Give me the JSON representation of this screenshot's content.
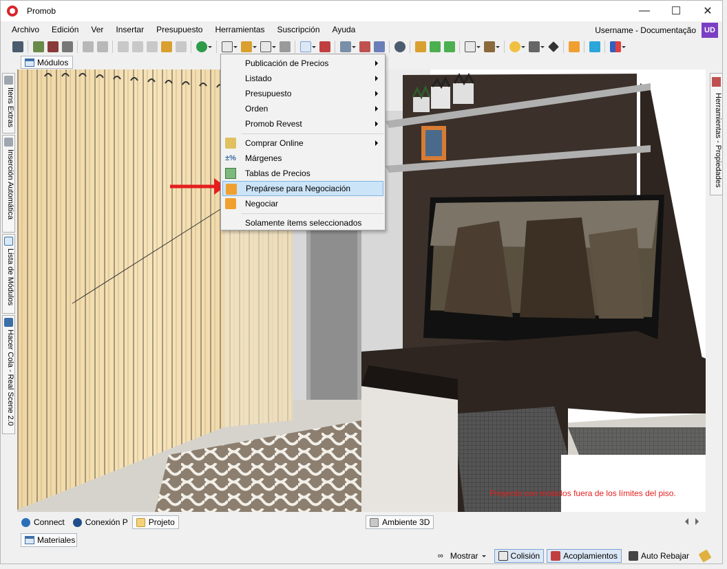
{
  "window": {
    "title": "Promob",
    "minimize": "—",
    "maximize": "☐",
    "close": "✕"
  },
  "menubar": {
    "items": [
      "Archivo",
      "Edición",
      "Ver",
      "Insertar",
      "Presupuesto",
      "Herramientas",
      "Suscripción",
      "Ayuda"
    ],
    "username": "Username - Documentação",
    "avatar_initials": "UD"
  },
  "modules_tab": {
    "label": "Módulos"
  },
  "left_sidebar": {
    "tabs": [
      "Itens Extras",
      "Inserción Automática",
      "Lista de Módulos",
      "Hacer Cola - Real Scene 2.0"
    ]
  },
  "right_sidebar": {
    "tab": "Herramientas - Propiedades"
  },
  "dropdown": {
    "items": [
      {
        "label": "Publicación de Precios",
        "submenu": true,
        "icon": ""
      },
      {
        "label": "Listado",
        "submenu": true,
        "icon": ""
      },
      {
        "label": "Presupuesto",
        "submenu": true,
        "icon": ""
      },
      {
        "label": "Orden",
        "submenu": true,
        "icon": ""
      },
      {
        "label": "Promob Revest",
        "submenu": true,
        "icon": ""
      },
      {
        "label": "Comprar Online",
        "submenu": true,
        "icon": "cart-money-icon"
      },
      {
        "label": "Márgenes",
        "submenu": false,
        "icon": "percent-icon"
      },
      {
        "label": "Tablas de Precios",
        "submenu": false,
        "icon": "price-table-icon"
      },
      {
        "label": "Prepárese para Negociación",
        "submenu": false,
        "icon": "save-disk-icon",
        "highlighted": true
      },
      {
        "label": "Negociar",
        "submenu": false,
        "icon": "person-icon"
      },
      {
        "label": "Solamente ítems seleccionados",
        "submenu": false,
        "icon": ""
      }
    ]
  },
  "viewport": {
    "warning": "Proyecto con módulos fuera de los límites del piso."
  },
  "bottom_tabs": {
    "items": [
      "Connect",
      "Conexión P",
      "Projeto"
    ],
    "active": "Projeto",
    "scene_tab": "Ambiente 3D"
  },
  "materials_tab": {
    "label": "Materiales"
  },
  "statusbar": {
    "show": "Mostrar",
    "collision": "Colisión",
    "couplings": "Acoplamientos",
    "auto_lower": "Auto Rebajar"
  },
  "colors": {
    "accent_highlight": "#cce4f7",
    "warning_red": "#e41e1e",
    "wall_dark": "#3b302a",
    "curtain": "#f4dfb0"
  }
}
